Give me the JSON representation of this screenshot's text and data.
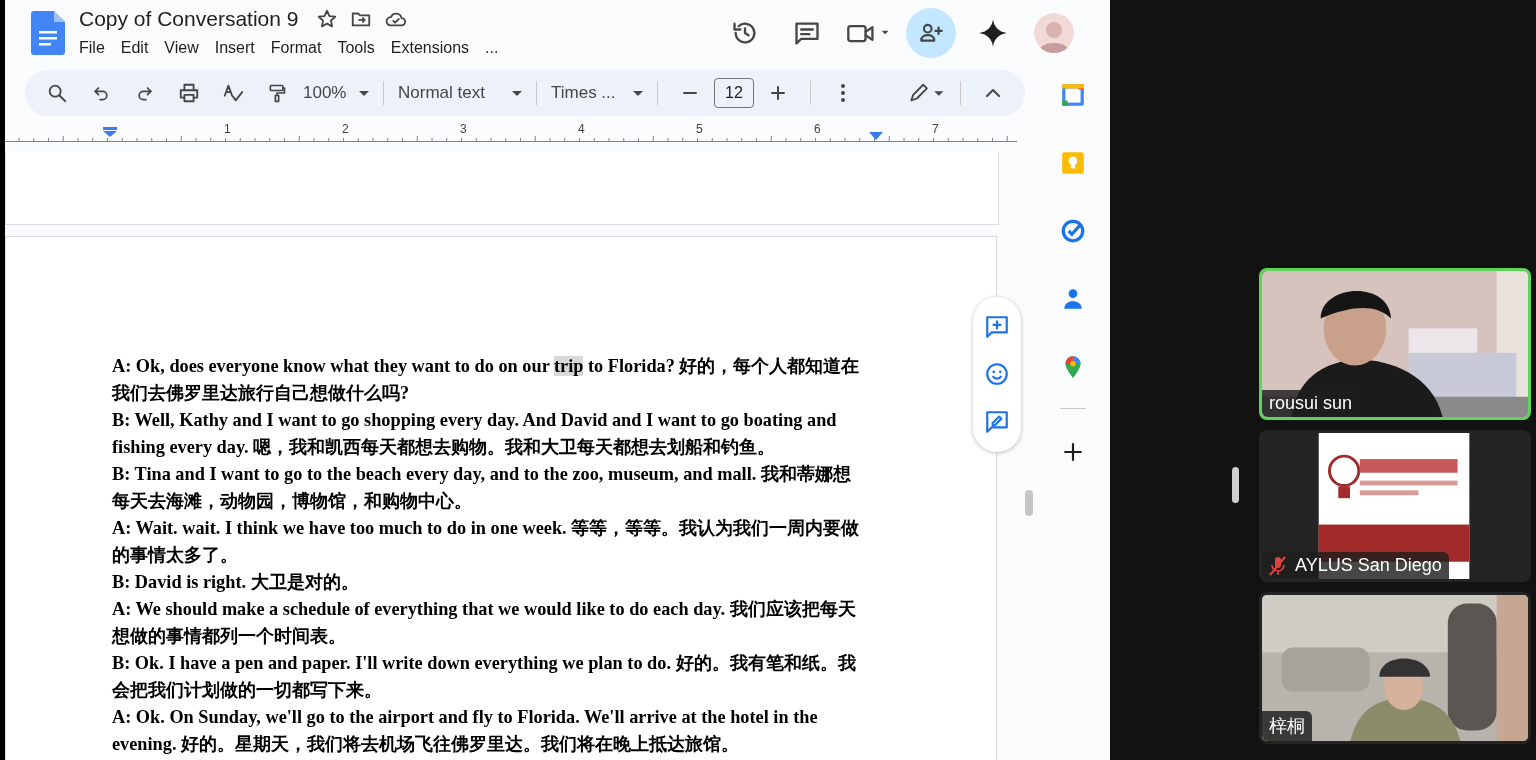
{
  "document": {
    "title": "Copy of Conversation 9",
    "menu": [
      "File",
      "Edit",
      "View",
      "Insert",
      "Format",
      "Tools",
      "Extensions",
      "..."
    ]
  },
  "toolbar": {
    "zoom": "100%",
    "style": "Normal text",
    "font": "Times ...",
    "font_size": "12"
  },
  "ruler": {
    "numbers": [
      "1",
      "2",
      "3",
      "4",
      "5",
      "6",
      "7"
    ]
  },
  "paragraphs": [
    {
      "segments": [
        {
          "text": "A: Ok, does everyone know what they want to do on our ",
          "highlighted": false
        },
        {
          "text": "trip",
          "highlighted": true
        },
        {
          "text": " to Florida? 好的，每个人都知道在我们去佛罗里达旅行自己想做什么吗?",
          "highlighted": false
        }
      ]
    },
    {
      "segments": [
        {
          "text": "B: Well, Kathy and I want to go shopping every day. And David and I want to go boating and fishing every day. 嗯，我和凯西每天都想去购物。我和大卫每天都想去划船和钓鱼。",
          "highlighted": false
        }
      ]
    },
    {
      "segments": [
        {
          "text": "B: Tina and I want to go to the beach every day, and to the zoo, museum, and mall. 我和蒂娜想每天去海滩，动物园，博物馆，和购物中心。",
          "highlighted": false
        }
      ]
    },
    {
      "segments": [
        {
          "text": "A: Wait. wait. I think we have too much to do in one week. 等等，等等。我认为我们一周内要做的事情太多了。",
          "highlighted": false
        }
      ]
    },
    {
      "segments": [
        {
          "text": "B: David is right. 大卫是对的。",
          "highlighted": false
        }
      ]
    },
    {
      "segments": [
        {
          "text": "A: We should make a schedule of everything that we would like to do each day. 我们应该把每天想做的事情都列一个时间表。",
          "highlighted": false
        }
      ]
    },
    {
      "segments": [
        {
          "text": "B: Ok. I have a pen and paper. I'll write down everything we plan to do. 好的。我有笔和纸。我会把我们计划做的一切都写下来。",
          "highlighted": false
        }
      ]
    },
    {
      "segments": [
        {
          "text": "A: Ok. On Sunday, we'll go to the airport and fly to Florida. We'll arrive at the hotel in the evening. 好的。星期天，我们将去机场飞往佛罗里达。我们将在晚上抵达旅馆。",
          "highlighted": false
        }
      ]
    }
  ],
  "participants": [
    {
      "name": "rousui sun",
      "kind": "webcam",
      "speaking": true,
      "muted": false
    },
    {
      "name": "AYLUS San Diego",
      "kind": "logo",
      "speaking": false,
      "muted": true
    },
    {
      "name": "梓桐",
      "kind": "webcam",
      "speaking": false,
      "muted": false
    }
  ]
}
